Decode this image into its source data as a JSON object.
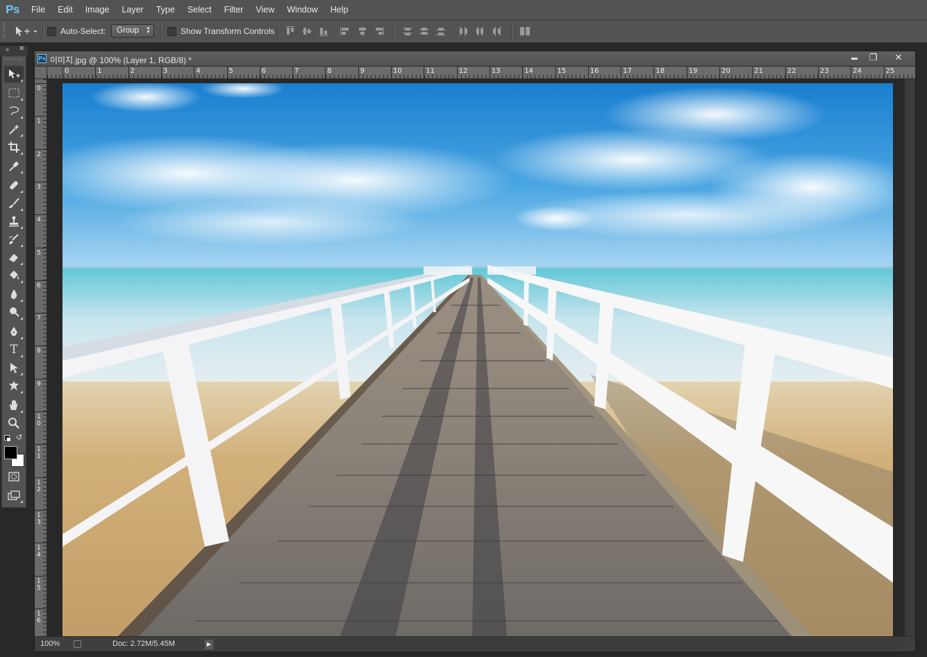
{
  "app": {
    "logo": "Ps"
  },
  "menu": [
    "File",
    "Edit",
    "Image",
    "Layer",
    "Type",
    "Select",
    "Filter",
    "View",
    "Window",
    "Help"
  ],
  "options_bar": {
    "auto_select_label": "Auto-Select:",
    "auto_select_checked": false,
    "auto_select_target": "Group",
    "transform_controls_label": "Show Transform Controls",
    "transform_controls_checked": false
  },
  "document": {
    "title": "이미지.jpg @ 100% (Layer 1, RGB/8) *",
    "window_buttons": {
      "minimize": "▬",
      "restore": "❐",
      "close": "✕"
    },
    "ruler_top_labels": [
      "0",
      "1",
      "2",
      "3",
      "4",
      "5",
      "6",
      "7",
      "8",
      "9",
      "10",
      "11",
      "12",
      "13",
      "14",
      "15",
      "16",
      "17",
      "18",
      "19",
      "20",
      "21",
      "22",
      "23",
      "24",
      "25"
    ],
    "ruler_left_labels": [
      "0",
      "1",
      "2",
      "3",
      "4",
      "5",
      "6",
      "7",
      "8",
      "9",
      "10",
      "11",
      "12",
      "13",
      "14",
      "15",
      "16"
    ],
    "zoom": "100%",
    "doc_size": "Doc: 2.72M/5.45M"
  },
  "tools": [
    "move-tool",
    "marquee-tool",
    "lasso-tool",
    "quick-selection-tool",
    "crop-tool",
    "eyedropper-tool",
    "healing-brush-tool",
    "brush-tool",
    "clone-stamp-tool",
    "history-brush-tool",
    "eraser-tool",
    "paint-bucket-tool",
    "blur-tool",
    "dodge-tool",
    "pen-tool",
    "type-tool",
    "path-selection-tool",
    "custom-shape-tool",
    "hand-tool",
    "zoom-tool"
  ],
  "colors": {
    "foreground": "#000000",
    "background": "#ffffff",
    "ui_panel": "#535353",
    "ui_dark": "#282828",
    "logo_blue": "#6ec5f5"
  }
}
